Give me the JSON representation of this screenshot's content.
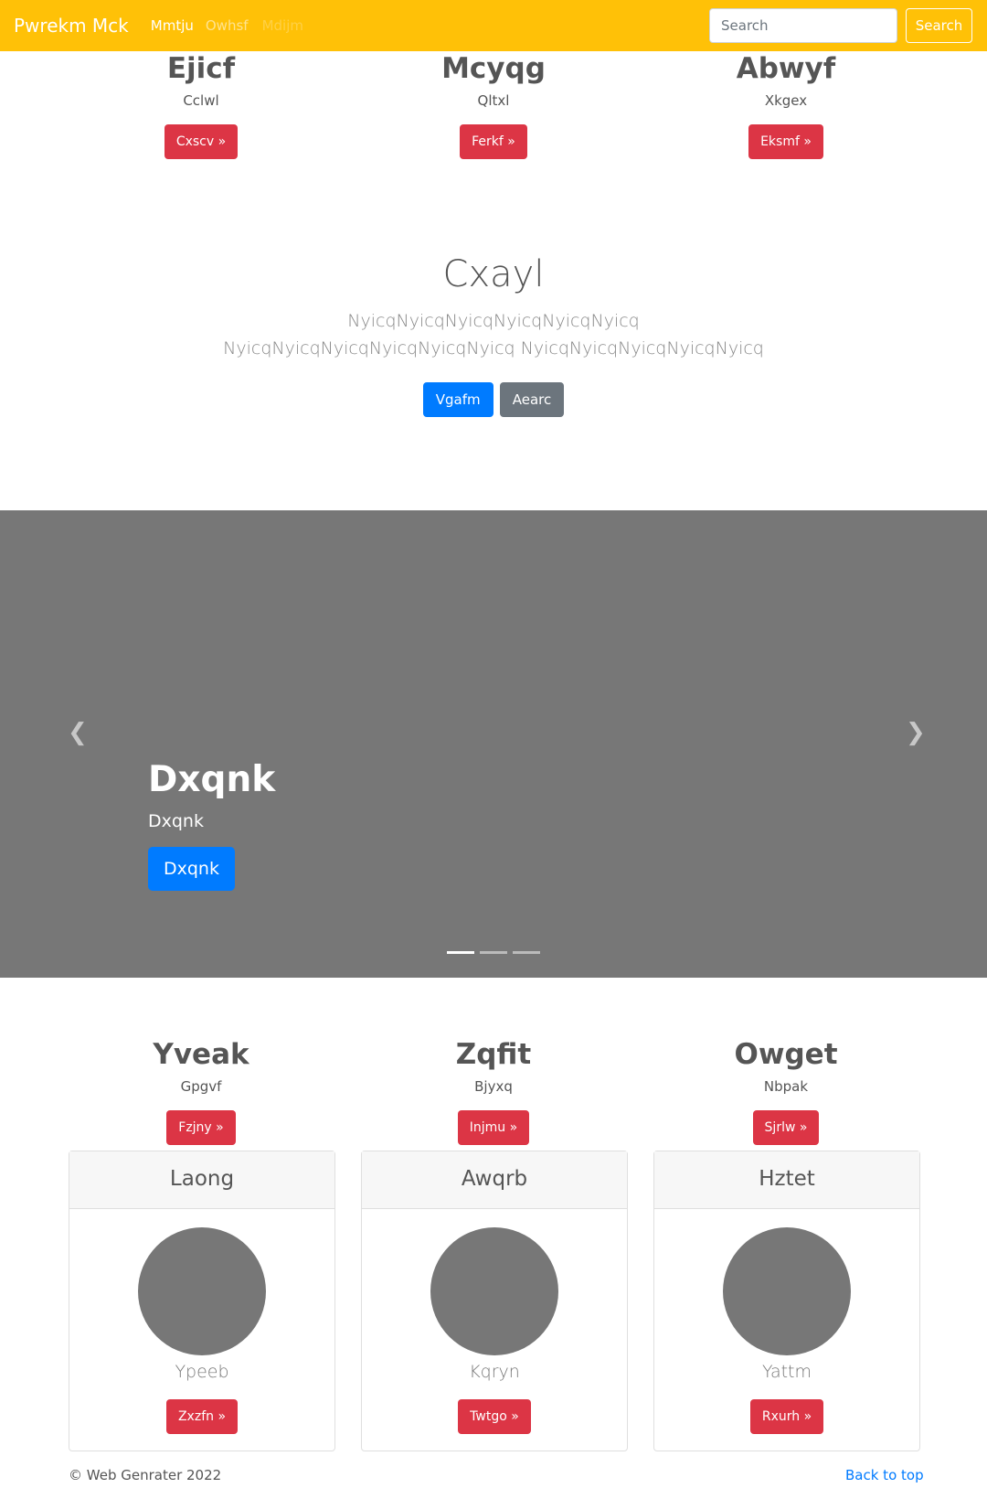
{
  "navbar": {
    "brand": "Pwrekm Mck",
    "links": [
      "Mmtju",
      "Owhsf",
      "Mdijm"
    ],
    "search_placeholder": "Search",
    "search_button": "Search",
    "color": "#ffc107"
  },
  "top_features": [
    {
      "title": "Ejicf",
      "subtitle": "Cclwl",
      "button": "Cxscv »"
    },
    {
      "title": "Mcyqg",
      "subtitle": "Qltxl",
      "button": "Ferkf »"
    },
    {
      "title": "Abwyf",
      "subtitle": "Xkgex",
      "button": "Eksmf »"
    }
  ],
  "hero": {
    "title": "Cxayl",
    "text": "NyicqNyicqNyicqNyicqNyicqNyicq NyicqNyicqNyicqNyicqNyicqNyicq NyicqNyicqNyicqNyicqNyicq",
    "primary_button": "Vgafm",
    "secondary_button": "Aearc"
  },
  "carousel": {
    "title": "Dxqnk",
    "subtitle": "Dxqnk",
    "button": "Dxqnk",
    "prev_icon": "chevron-left-icon",
    "next_icon": "chevron-right-icon",
    "active_slide": 1,
    "slide_count": 3
  },
  "mid_features": [
    {
      "title": "Yveak",
      "subtitle": "Gpgvf",
      "button": "Fzjny »"
    },
    {
      "title": "Zqfit",
      "subtitle": "Bjyxq",
      "button": "Injmu »"
    },
    {
      "title": "Owget",
      "subtitle": "Nbpak",
      "button": "Sjrlw »"
    }
  ],
  "cards": [
    {
      "header": "Laong",
      "name": "Ypeeb",
      "button": "Zxzfn »"
    },
    {
      "header": "Awqrb",
      "name": "Kqryn",
      "button": "Twtgo »"
    },
    {
      "header": "Hztet",
      "name": "Yattm",
      "button": "Rxurh »"
    }
  ],
  "footer": {
    "copyright": "© Web Genrater 2022",
    "back_to_top": "Back to top"
  },
  "colors": {
    "danger": "#dc3545",
    "primary": "#007bff",
    "secondary": "#6c757d",
    "carousel_bg": "#777777"
  }
}
